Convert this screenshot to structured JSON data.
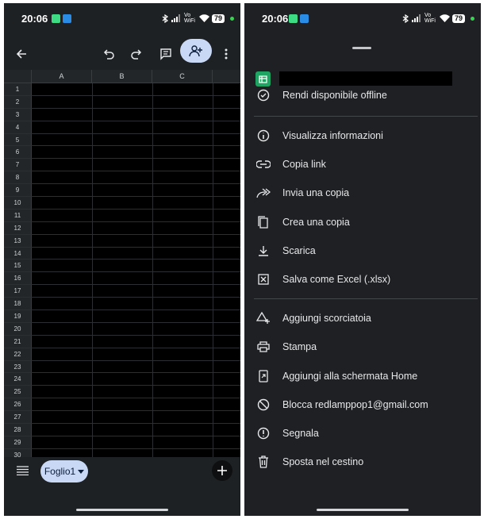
{
  "left": {
    "status": {
      "time": "20:06",
      "battery": "79",
      "net_label": "Vo WiFi"
    },
    "columns": [
      "A",
      "B",
      "C"
    ],
    "rows": [
      "1",
      "2",
      "3",
      "4",
      "5",
      "6",
      "7",
      "8",
      "9",
      "10",
      "11",
      "12",
      "13",
      "14",
      "15",
      "16",
      "17",
      "18",
      "19",
      "20",
      "21",
      "22",
      "23",
      "24",
      "25",
      "26",
      "27",
      "28",
      "29",
      "30"
    ],
    "sheet_tab": "Foglio1"
  },
  "right": {
    "status": {
      "time": "20:06",
      "battery": "79",
      "net_label": "Vo WiFi"
    },
    "menu": [
      {
        "label": "Rendi disponibile offline",
        "icon": "offline-icon"
      },
      {
        "label": "Visualizza informazioni",
        "icon": "info-icon"
      },
      {
        "label": "Copia link",
        "icon": "link-icon"
      },
      {
        "label": "Invia una copia",
        "icon": "forward-icon"
      },
      {
        "label": "Crea una copia",
        "icon": "copy-icon"
      },
      {
        "label": "Scarica",
        "icon": "download-icon"
      },
      {
        "label": "Salva come Excel (.xlsx)",
        "icon": "excel-icon"
      },
      {
        "label": "Aggiungi scorciatoia",
        "icon": "shortcut-icon"
      },
      {
        "label": "Stampa",
        "icon": "print-icon"
      },
      {
        "label": "Aggiungi alla schermata Home",
        "icon": "home-screen-icon"
      },
      {
        "label": "Blocca redlamppop1@gmail.com",
        "icon": "block-icon"
      },
      {
        "label": "Segnala",
        "icon": "report-icon"
      },
      {
        "label": "Sposta nel cestino",
        "icon": "trash-icon"
      }
    ]
  },
  "colors": {
    "accent": "#c8d8f5",
    "sheets_green": "#1fa463",
    "bg": "#1e2124"
  }
}
